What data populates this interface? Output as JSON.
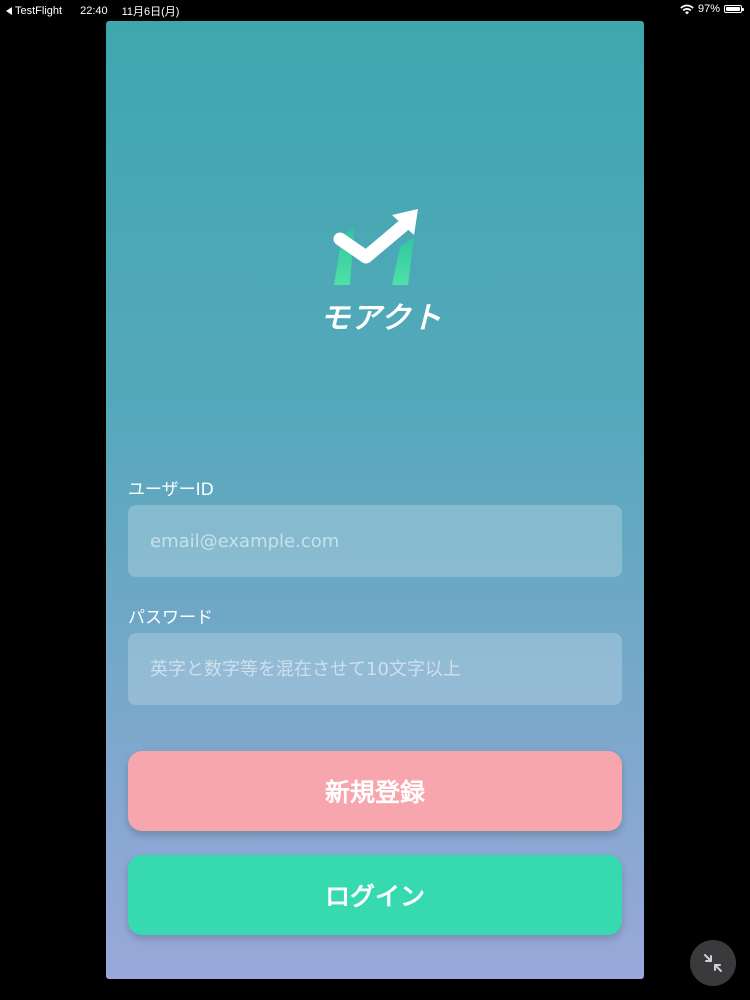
{
  "status_bar": {
    "back_app": "TestFlight",
    "time": "22:40",
    "date": "11月6日(月)",
    "battery_percent": "97%",
    "battery_level": 0.97,
    "wifi_icon": "wifi-icon",
    "battery_icon": "battery-icon"
  },
  "app": {
    "logo_text": "モアクト",
    "logo_icon": "logo-m-arrow-icon",
    "user_id": {
      "label": "ユーザーID",
      "value": "",
      "placeholder": "email@example.com"
    },
    "password": {
      "label": "パスワード",
      "value": "",
      "placeholder": "英字と数字等を混在させて10文字以上"
    },
    "register_button": "新規登録",
    "login_button": "ログイン"
  },
  "overlay": {
    "minimize_icon": "minimize-arrows-icon"
  },
  "colors": {
    "gradient_top": "#3ea7ae",
    "gradient_bottom": "#9aa8da",
    "register_button": "#f7a6ad",
    "login_button": "#36d9b0",
    "logo_green": "#4fe0a8"
  }
}
